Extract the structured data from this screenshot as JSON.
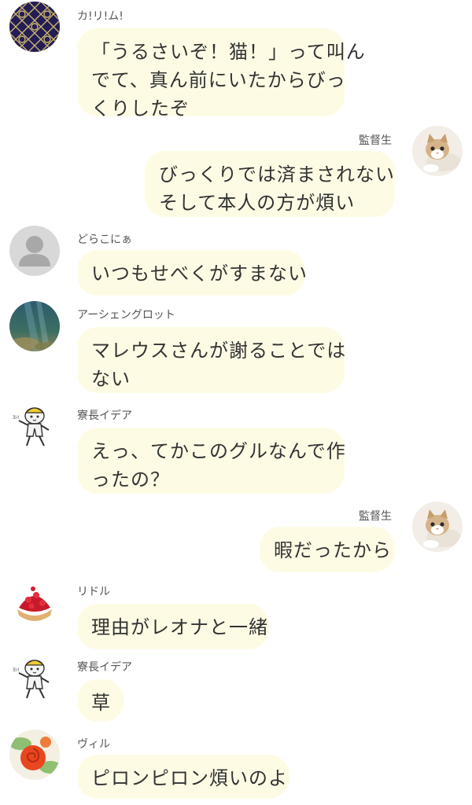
{
  "messages": [
    {
      "sender": "カ!リ!ム!",
      "side": "left",
      "avatar_icon": "geometric-pattern-avatar-icon",
      "lines": [
        "「うるさいぞ！猫！」って叫ん",
        "でて、真ん前にいたからびっ",
        "くりしたぞ"
      ]
    },
    {
      "sender": "監督生",
      "side": "right",
      "avatar_icon": "kitten-avatar-icon",
      "lines": [
        "びっくりでは済まされない",
        "そして本人の方が煩い"
      ]
    },
    {
      "sender": "どらこにぁ",
      "side": "left",
      "avatar_icon": "default-user-avatar-icon",
      "lines": [
        "いつもせべくがすまない"
      ]
    },
    {
      "sender": "アーシェングロット",
      "side": "left",
      "avatar_icon": "underwater-avatar-icon",
      "lines": [
        "マレウスさんが謝ることでは",
        "ない"
      ]
    },
    {
      "sender": "寮長イデア",
      "side": "left",
      "avatar_icon": "cat-worker-avatar-icon",
      "lines": [
        "えっ、てかこのグルなんで作",
        "ったの？"
      ]
    },
    {
      "sender": "監督生",
      "side": "right",
      "avatar_icon": "kitten-avatar-icon",
      "lines": [
        "暇だったから"
      ]
    },
    {
      "sender": "リドル",
      "side": "left",
      "avatar_icon": "strawberry-tart-avatar-icon",
      "lines": [
        "理由がレオナと一緒"
      ]
    },
    {
      "sender": "寮長イデア",
      "side": "left",
      "avatar_icon": "cat-worker-avatar-icon",
      "lines": [
        "草"
      ]
    },
    {
      "sender": "ヴィル",
      "side": "left",
      "avatar_icon": "rose-avatar-icon",
      "lines": [
        "ピロンピロン煩いのよ"
      ]
    }
  ],
  "colors": {
    "bubble": "#fefbe5",
    "text": "#333333",
    "name": "#555555",
    "background": "#ffffff"
  }
}
